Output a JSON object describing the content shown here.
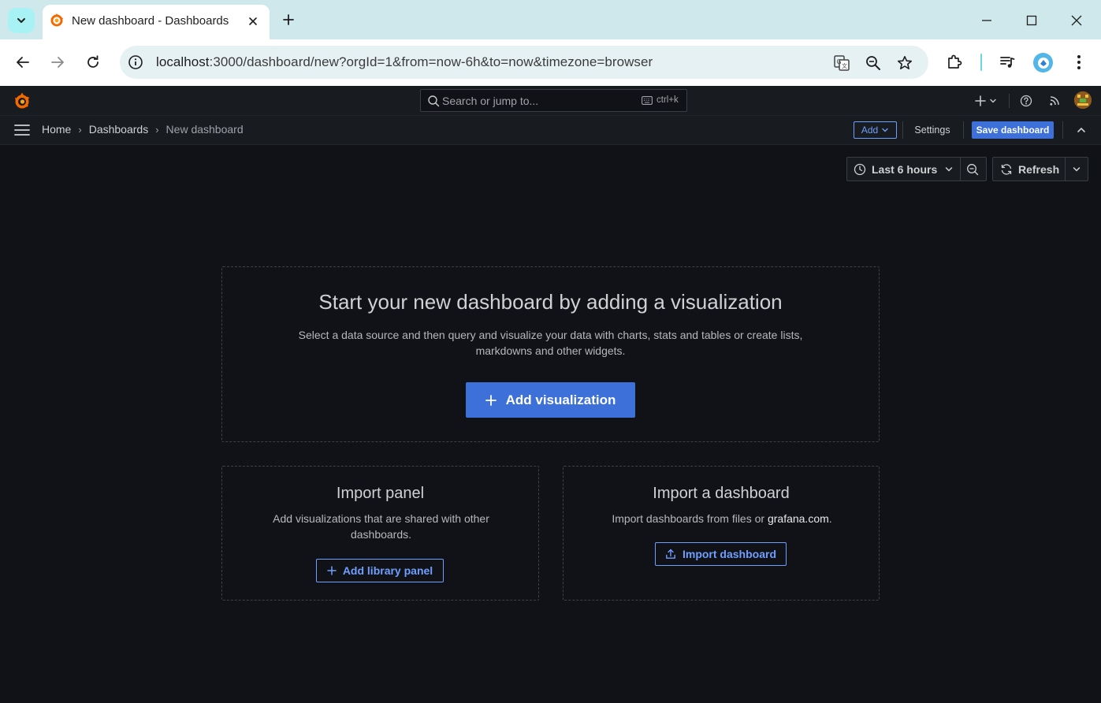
{
  "browser": {
    "tab_title": "New dashboard - Dashboards",
    "url_host": "localhost",
    "url_rest": ":3000/dashboard/new?orgId=1&from=now-6h&to=now&timezone=browser"
  },
  "grafana": {
    "search_placeholder": "Search or jump to...",
    "search_shortcut": "ctrl+k",
    "breadcrumbs": {
      "home": "Home",
      "dashboards": "Dashboards",
      "current": "New dashboard"
    },
    "add_label": "Add",
    "settings_label": "Settings",
    "save_label": "Save dashboard",
    "time_range_label": "Last 6 hours",
    "refresh_label": "Refresh"
  },
  "empty_state": {
    "title": "Start your new dashboard by adding a visualization",
    "description": "Select a data source and then query and visualize your data with charts, stats and tables or create lists, markdowns and other widgets.",
    "add_visualization_label": "Add visualization",
    "import_panel": {
      "title": "Import panel",
      "description": "Add visualizations that are shared with other dashboards.",
      "button_label": "Add library panel"
    },
    "import_dashboard": {
      "title": "Import a dashboard",
      "description_prefix": "Import dashboards from files or ",
      "link_text": "grafana.com",
      "description_suffix": ".",
      "button_label": "Import dashboard"
    }
  },
  "colors": {
    "page_bg": "#111217",
    "panel_bg": "#181b1f",
    "primary": "#3d71d9",
    "primary_text": "#6e9fff",
    "text": "#d0d1d3"
  }
}
